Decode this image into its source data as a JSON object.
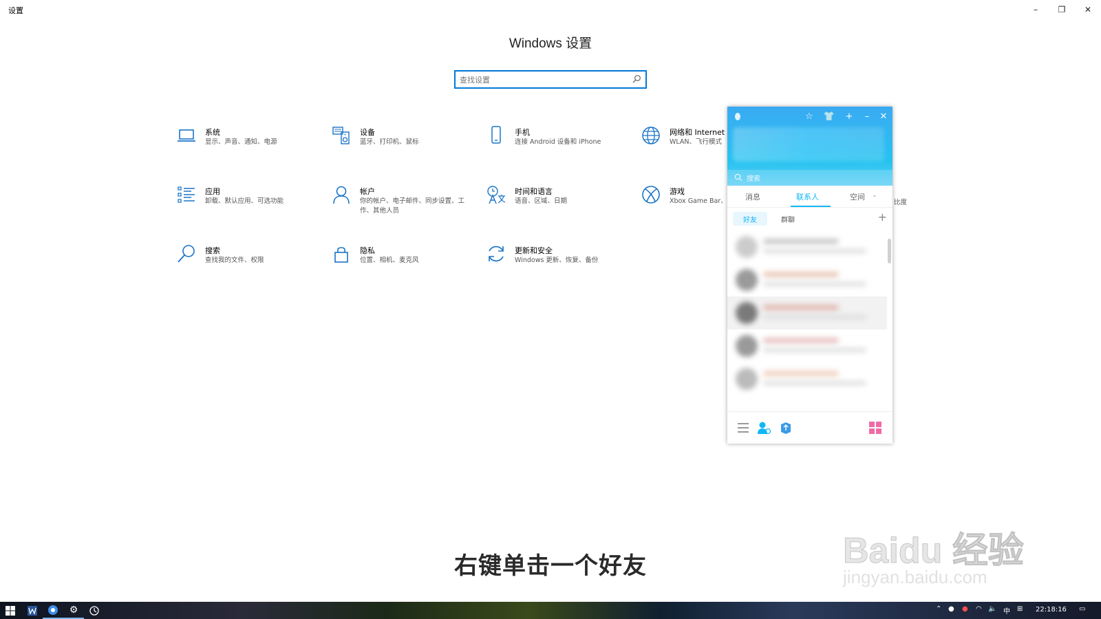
{
  "window": {
    "title": "设置",
    "minimize": "–",
    "restore": "❐",
    "close": "✕"
  },
  "heading": "Windows 设置",
  "search": {
    "placeholder": "查找设置"
  },
  "tiles": [
    {
      "name": "系统",
      "desc": "显示、声音、通知、电源",
      "icon": "laptop-icon"
    },
    {
      "name": "设备",
      "desc": "蓝牙、打印机、鼠标",
      "icon": "keyboard-speaker-icon"
    },
    {
      "name": "手机",
      "desc": "连接 Android 设备和 iPhone",
      "icon": "phone-icon"
    },
    {
      "name": "网络和 Internet",
      "desc": "WLAN、飞行模式",
      "icon": "globe-icon"
    },
    {
      "name": "应用",
      "desc": "卸载、默认应用、可选功能",
      "icon": "apps-list-icon"
    },
    {
      "name": "帐户",
      "desc": "你的帐户、电子邮件、同步设置、工作、其他人员",
      "icon": "person-icon"
    },
    {
      "name": "时间和语言",
      "desc": "语音、区域、日期",
      "icon": "time-language-icon"
    },
    {
      "name": "游戏",
      "desc": "Xbox Game Bar、模式",
      "icon": "xbox-icon"
    },
    {
      "name": "搜索",
      "desc": "查找我的文件、权限",
      "icon": "search-icon"
    },
    {
      "name": "隐私",
      "desc": "位置、相机、麦克风",
      "icon": "lock-icon"
    },
    {
      "name": "更新和安全",
      "desc": "Windows 更新、恢复、备份",
      "icon": "refresh-icon"
    }
  ],
  "hidden_fragment": "比度",
  "qq": {
    "search_label": "搜索",
    "tabs": [
      "消息",
      "联系人",
      "空间"
    ],
    "active_tab": "联系人",
    "sub_tabs": [
      "好友",
      "群聊"
    ],
    "add": "+",
    "accent": "#12b7f5",
    "header_color": "#27c3f0"
  },
  "caption": "右键单击一个好友",
  "watermark": {
    "line1": "Baidu 经验",
    "line2": "jingyan.baidu.com"
  },
  "taskbar": {
    "ime": "中",
    "clock": "22:18:16"
  }
}
